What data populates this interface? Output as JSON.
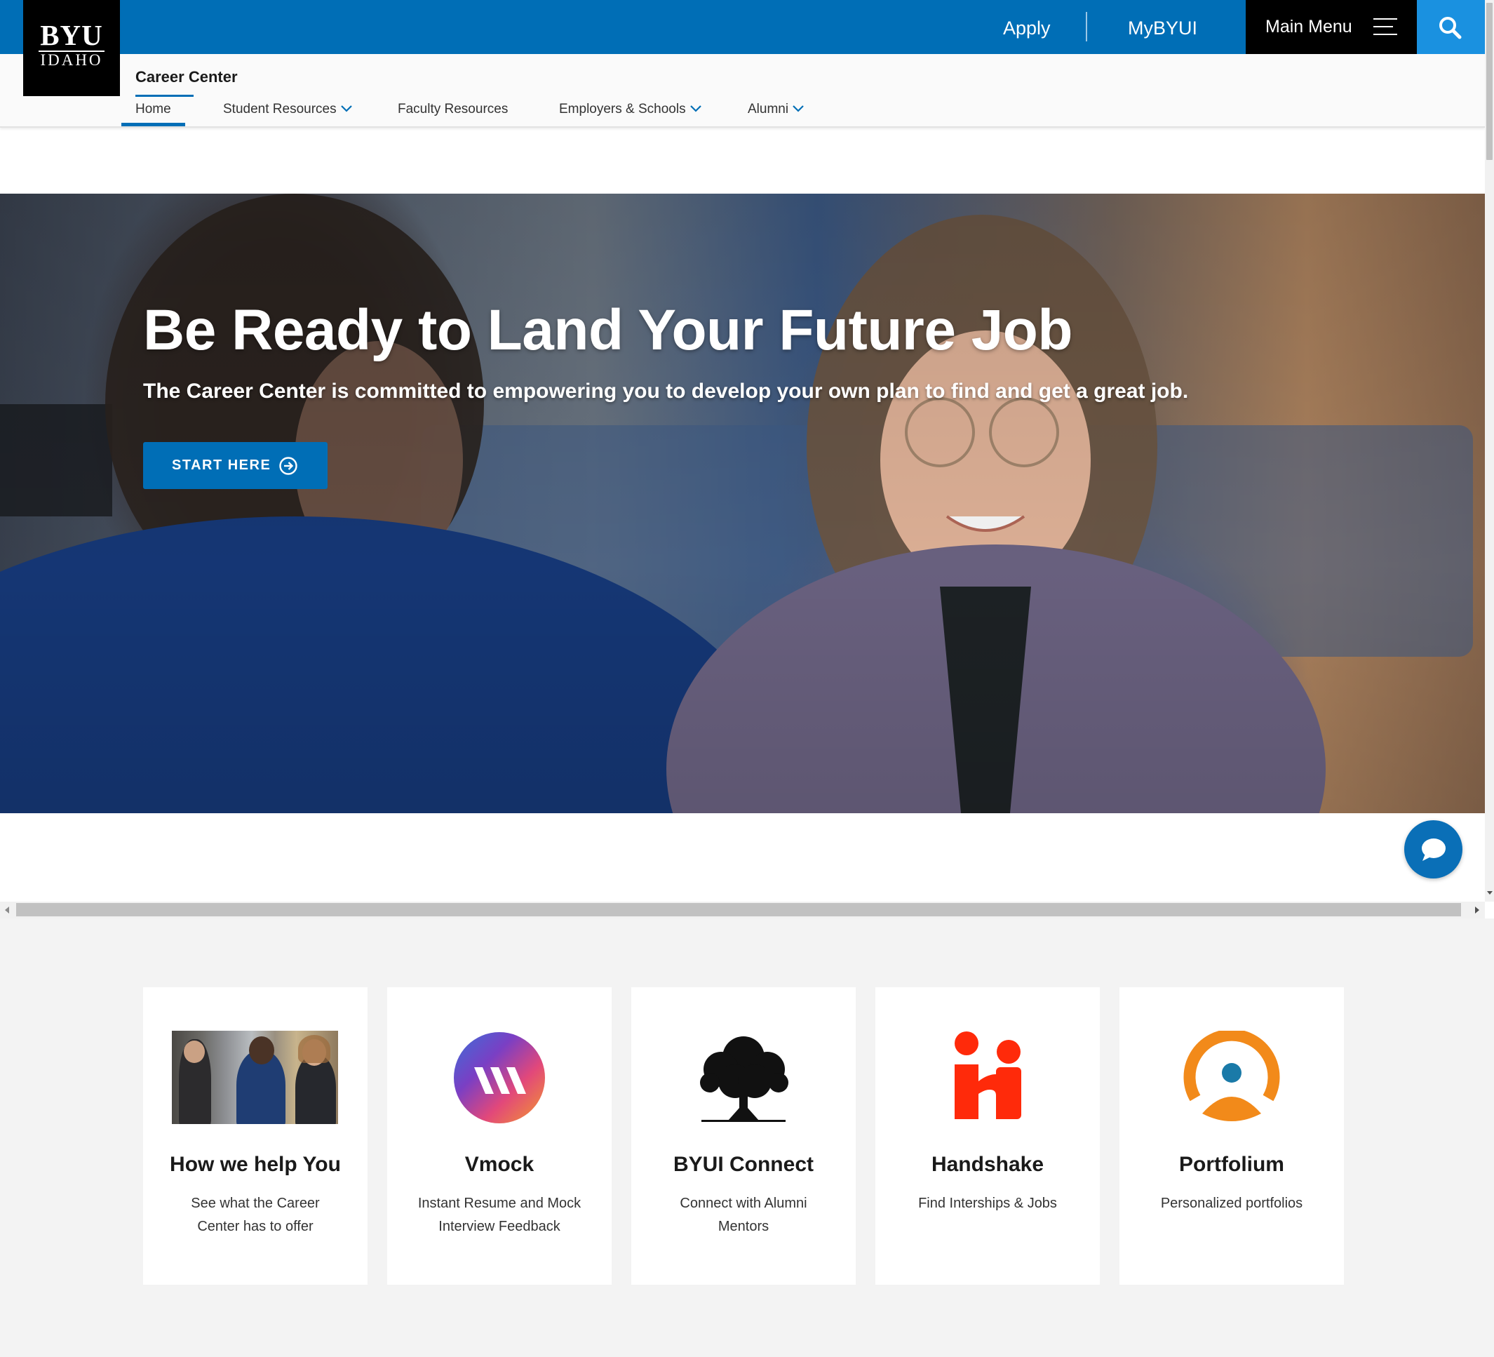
{
  "header": {
    "logo_top": "BYU",
    "logo_bottom": "IDAHO",
    "apply": "Apply",
    "mybyui": "MyBYUI",
    "main_menu": "Main Menu"
  },
  "subnav": {
    "site_title": "Career Center",
    "items": [
      {
        "label": "Home",
        "active": true,
        "dropdown": false
      },
      {
        "label": "Student Resources",
        "active": false,
        "dropdown": true
      },
      {
        "label": "Faculty Resources",
        "active": false,
        "dropdown": false
      },
      {
        "label": "Employers & Schools",
        "active": false,
        "dropdown": true
      },
      {
        "label": "Alumni",
        "active": false,
        "dropdown": true
      }
    ]
  },
  "hero": {
    "title": "Be Ready to Land Your Future Job",
    "subtitle": "The Career Center is committed to empowering you to develop your own plan to find and get a great job.",
    "cta": "START HERE"
  },
  "cards": [
    {
      "title": "How we help You",
      "description": "See what the Career Center has to offer",
      "icon": "students-photo"
    },
    {
      "title": "Vmock",
      "description": "Instant Resume and Mock Interview Feedback",
      "icon": "vmock-logo"
    },
    {
      "title": "BYUI Connect",
      "description": "Connect with Alumni Mentors",
      "icon": "tree-icon"
    },
    {
      "title": "Handshake",
      "description": "Find Interships & Jobs",
      "icon": "handshake-logo"
    },
    {
      "title": "Portfolium",
      "description": "Personalized portfolios",
      "icon": "portfolium-logo"
    }
  ],
  "colors": {
    "brand_blue": "#006eb6",
    "search_blue": "#1a91e0",
    "handshake_red": "#ff2a0a",
    "portfolium_orange": "#f28a1a"
  }
}
